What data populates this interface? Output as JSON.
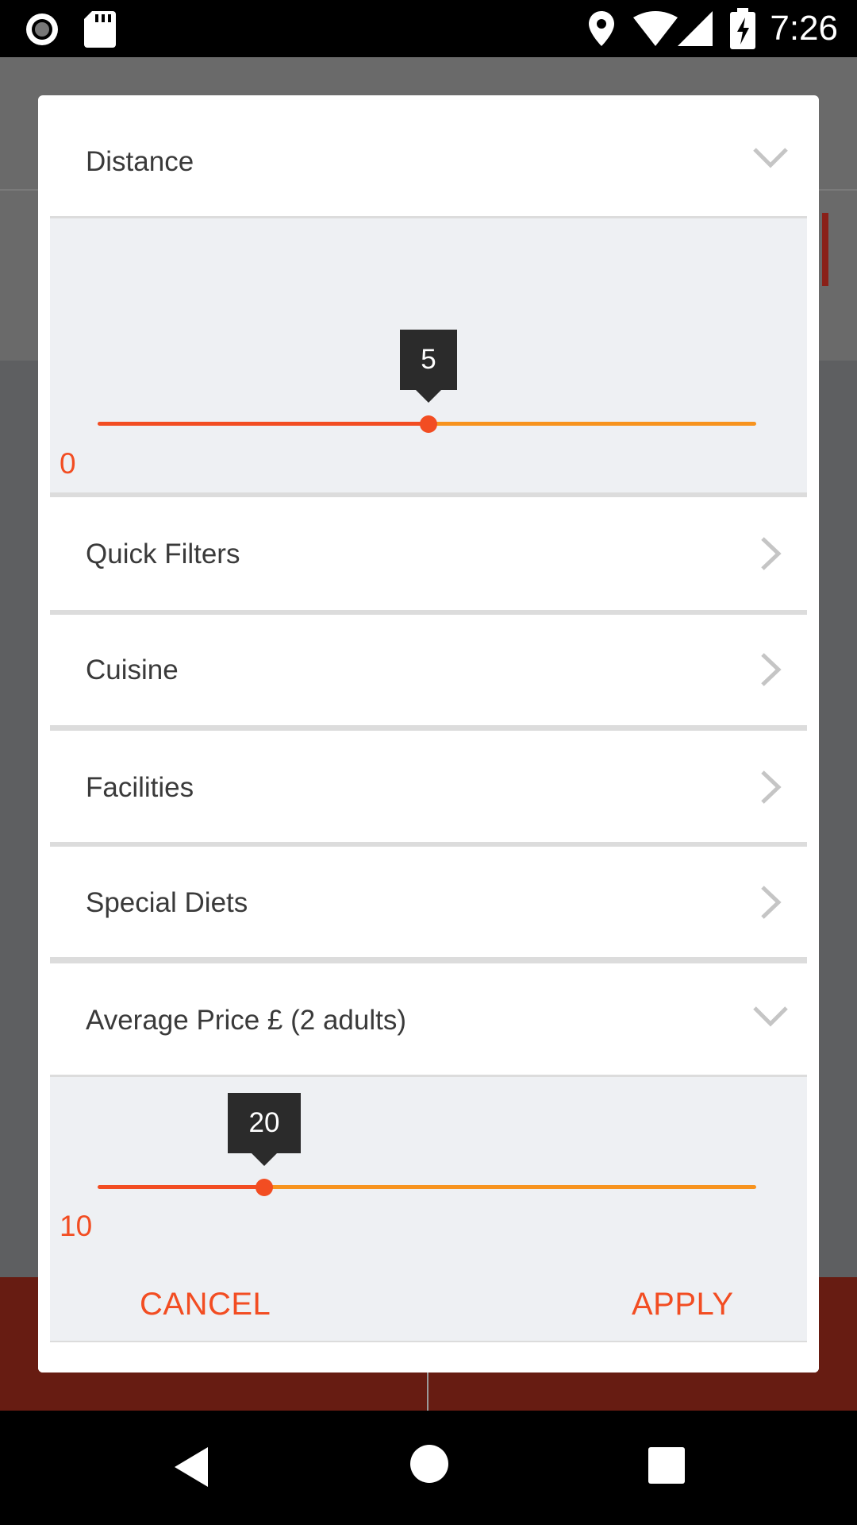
{
  "status_bar": {
    "time": "7:26",
    "icons": [
      "record-icon",
      "sd-card-icon",
      "location-icon",
      "wifi-icon",
      "signal-icon",
      "battery-charging-icon"
    ]
  },
  "dialog": {
    "sections": {
      "distance": {
        "label": "Distance",
        "state": "expanded"
      },
      "quick_filters": {
        "label": "Quick Filters"
      },
      "cuisine": {
        "label": "Cuisine"
      },
      "facilities": {
        "label": "Facilities"
      },
      "special_diets": {
        "label": "Special Diets"
      },
      "average_price": {
        "label": "Average Price £ (2 adults)",
        "state": "expanded"
      }
    },
    "distance_slider": {
      "min_label": "0",
      "value": "5",
      "fraction": 0.5
    },
    "price_slider": {
      "min_label": "10",
      "value": "20",
      "fraction": 0.25
    },
    "actions": {
      "cancel": "CANCEL",
      "apply": "APPLY"
    }
  },
  "colors": {
    "accent": "#f24d22",
    "track_remaining": "#f7931e",
    "panel_bg": "#eef0f3",
    "tooltip_bg": "#2b2b2b"
  },
  "nav_bar": {
    "buttons": [
      "back-icon",
      "home-icon",
      "recents-icon"
    ]
  }
}
